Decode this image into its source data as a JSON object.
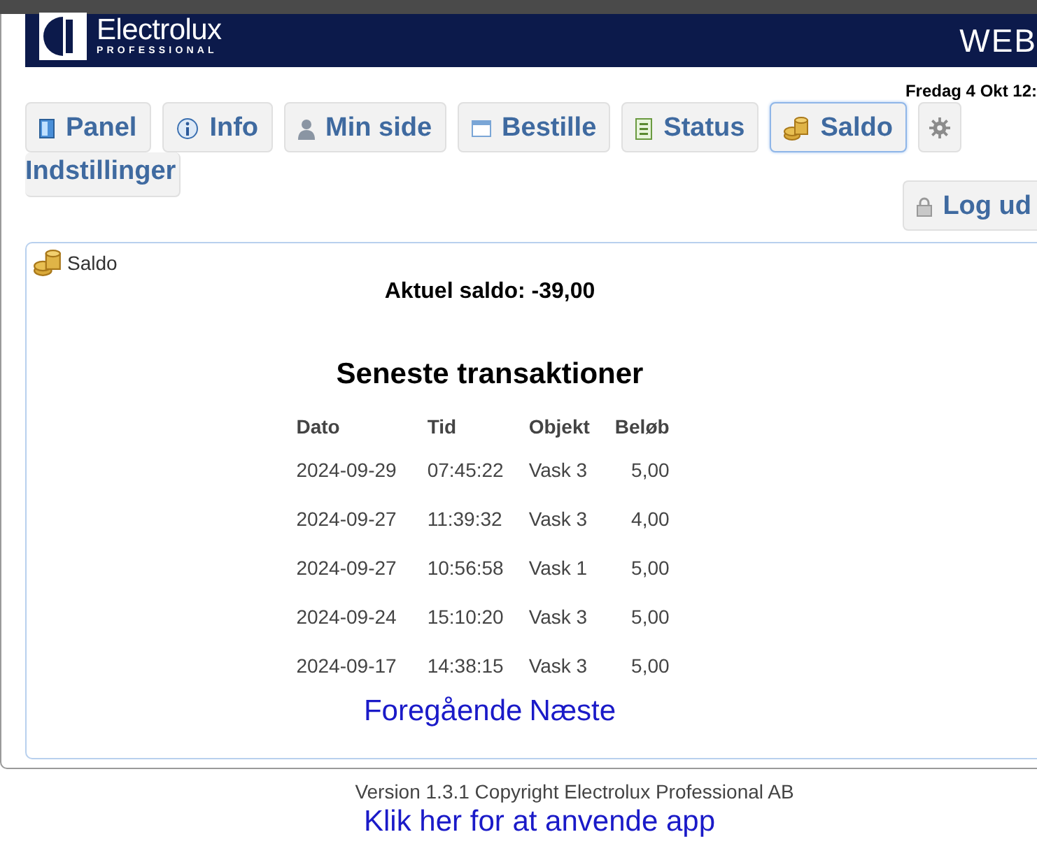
{
  "header": {
    "brand": "Electrolux",
    "brand_sub": "PROFESSIONAL",
    "right_text": "WEB"
  },
  "date": "Fredag 4 Okt 12:",
  "tabs": [
    {
      "label": "Panel",
      "selected": false
    },
    {
      "label": "Info",
      "selected": false
    },
    {
      "label": "Min side",
      "selected": false
    },
    {
      "label": "Bestille",
      "selected": false
    },
    {
      "label": "Status",
      "selected": false
    },
    {
      "label": "Saldo",
      "selected": true
    },
    {
      "label": "Indstillinger",
      "selected": false
    }
  ],
  "logout": {
    "label": "Log ud"
  },
  "panel": {
    "title": "Saldo",
    "balance": "Aktuel saldo: -39,00",
    "heading": "Seneste transaktioner",
    "columns": [
      "Dato",
      "Tid",
      "Objekt",
      "Beløb"
    ],
    "rows": [
      [
        "2024-09-29",
        "07:45:22",
        "Vask 3",
        "5,00"
      ],
      [
        "2024-09-27",
        "11:39:32",
        "Vask 3",
        "4,00"
      ],
      [
        "2024-09-27",
        "10:56:58",
        "Vask 1",
        "5,00"
      ],
      [
        "2024-09-24",
        "15:10:20",
        "Vask 3",
        "5,00"
      ],
      [
        "2024-09-17",
        "14:38:15",
        "Vask 3",
        "5,00"
      ]
    ],
    "prev": "Foregående",
    "next": "Næste"
  },
  "footer": {
    "version": "Version 1.3.1 Copyright Electrolux Professional AB",
    "app_link": "Klik her for at anvende app"
  }
}
